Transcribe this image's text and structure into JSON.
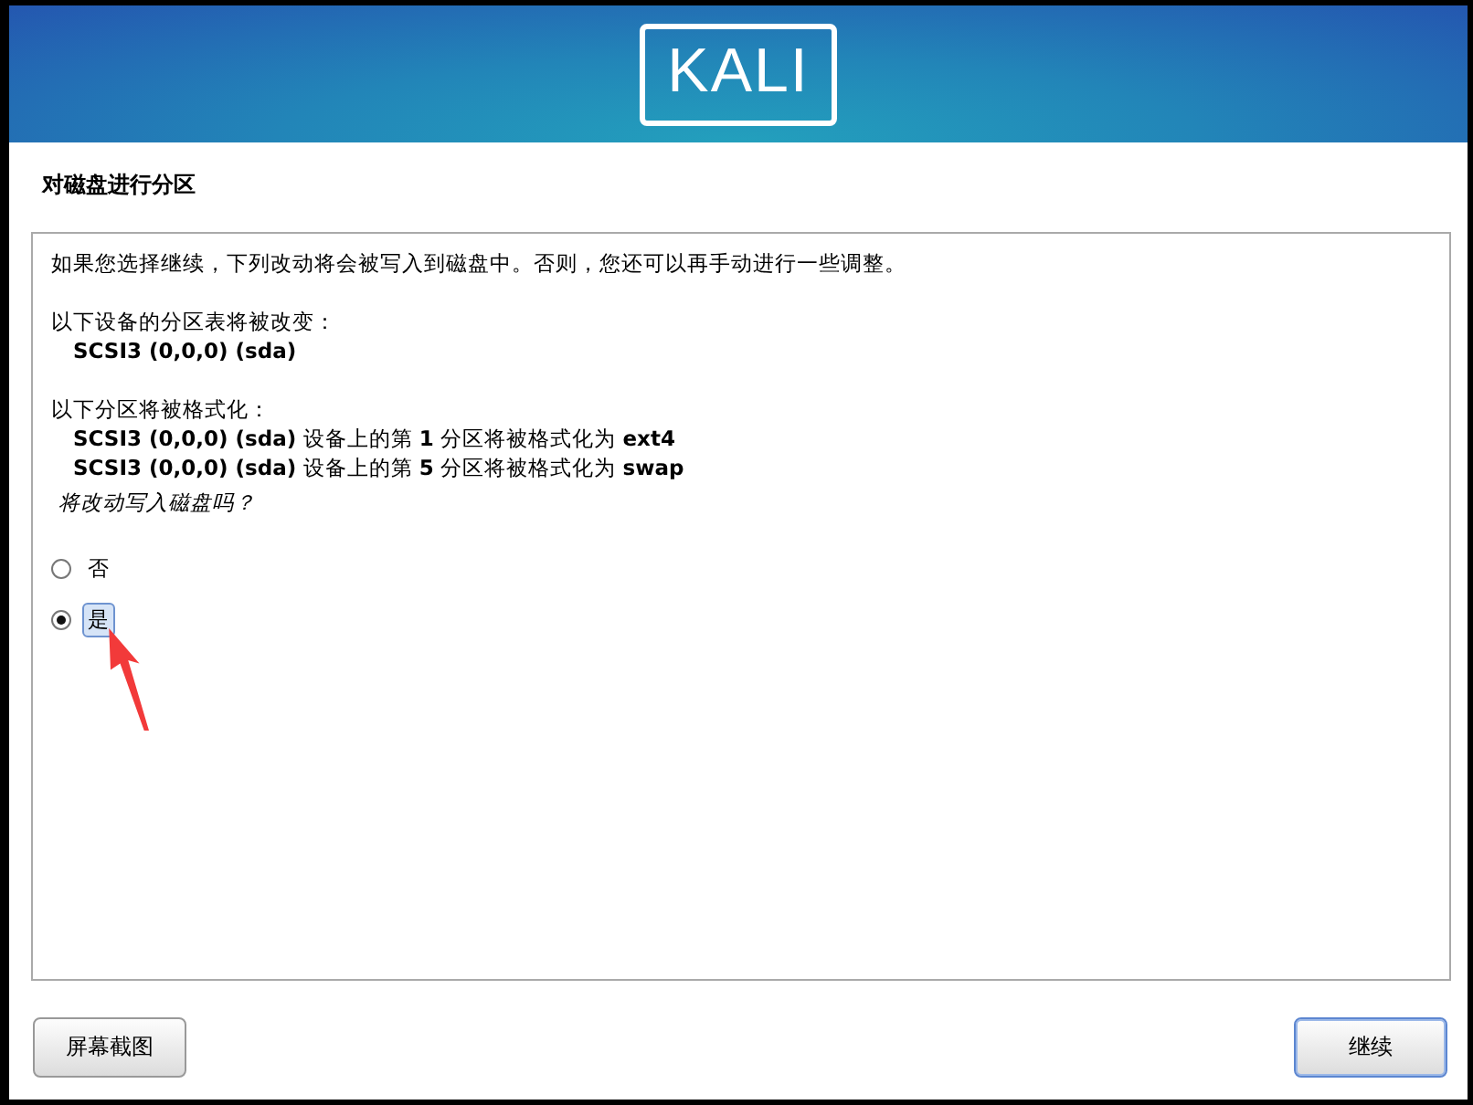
{
  "header": {
    "logo": "KALI"
  },
  "title": "对磁盘进行分区",
  "body": {
    "intro": "如果您选择继续，下列改动将会被写入到磁盘中。否则，您还可以再手动进行一些调整。",
    "sections": [
      {
        "heading": "以下设备的分区表将被改变：",
        "items": [
          "**SCSI3 (0,0,0) (sda)**"
        ]
      },
      {
        "heading": "以下分区将被格式化：",
        "items": [
          "**SCSI3 (0,0,0) (sda)** 设备上的第 **1** 分区将被格式化为 **ext4**",
          "**SCSI3 (0,0,0) (sda)** 设备上的第 **5** 分区将被格式化为 **swap**"
        ]
      }
    ],
    "question": "将改动写入磁盘吗？",
    "options": [
      {
        "label": "否",
        "selected": false
      },
      {
        "label": "是",
        "selected": true
      }
    ]
  },
  "buttons": [
    {
      "label": "屏幕截图",
      "kind": "secondary"
    },
    {
      "label": "继续",
      "kind": "primary"
    }
  ]
}
